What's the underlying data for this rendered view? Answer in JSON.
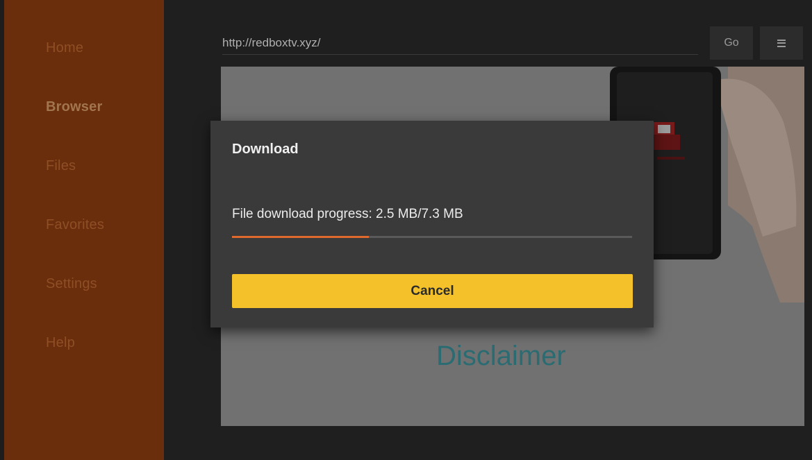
{
  "sidebar": {
    "items": [
      {
        "label": "Home",
        "active": false
      },
      {
        "label": "Browser",
        "active": true
      },
      {
        "label": "Files",
        "active": false
      },
      {
        "label": "Favorites",
        "active": false
      },
      {
        "label": "Settings",
        "active": false
      },
      {
        "label": "Help",
        "active": false
      }
    ]
  },
  "toolbar": {
    "url_value": "http://redboxtv.xyz/",
    "go_label": "Go",
    "menu_icon": "hamburger-menu-icon"
  },
  "web_page": {
    "heading": "Disclaimer"
  },
  "dialog": {
    "title": "Download",
    "progress_text": "File download progress: 2.5 MB/7.3 MB",
    "progress_current_mb": 2.5,
    "progress_total_mb": 7.3,
    "cancel_label": "Cancel"
  },
  "colors": {
    "sidebar_bg": "#6a2e0d",
    "progress_fill": "#e06a2d",
    "cancel_button": "#f4c12b",
    "dialog_bg": "#3a3a3a"
  }
}
